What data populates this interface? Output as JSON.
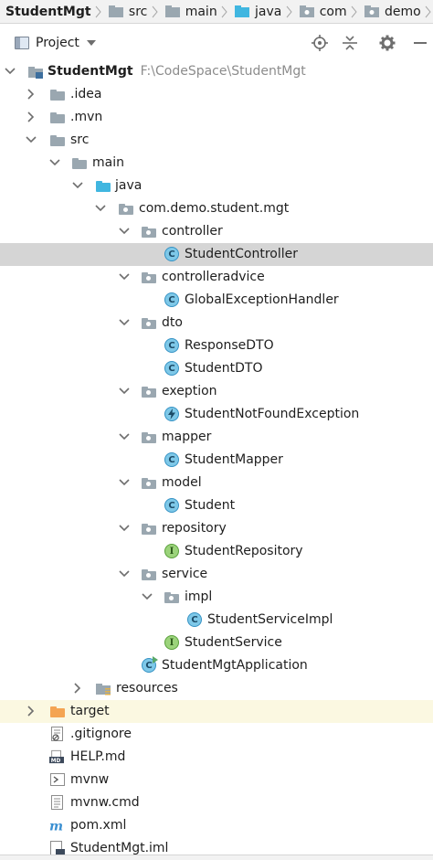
{
  "breadcrumb": [
    {
      "label": "StudentMgt",
      "icon": "module-folder-icon"
    },
    {
      "label": "src",
      "icon": "folder-icon"
    },
    {
      "label": "main",
      "icon": "folder-icon"
    },
    {
      "label": "java",
      "icon": "source-folder-icon"
    },
    {
      "label": "com",
      "icon": "package-icon"
    },
    {
      "label": "demo",
      "icon": "package-icon"
    }
  ],
  "toolbar": {
    "view_label": "Project",
    "buttons": [
      "locate-icon",
      "collapse-all-icon",
      "gear-icon",
      "hide-icon"
    ]
  },
  "tree": {
    "root_label": "StudentMgt",
    "root_path": "F:\\CodeSpace\\StudentMgt",
    "idea": ".idea",
    "mvn": ".mvn",
    "src": "src",
    "main": "main",
    "java": "java",
    "package": "com.demo.student.mgt",
    "controller": "controller",
    "StudentController": "StudentController",
    "controlleradvice": "controlleradvice",
    "GlobalExceptionHandler": "GlobalExceptionHandler",
    "dto": "dto",
    "ResponseDTO": "ResponseDTO",
    "StudentDTO": "StudentDTO",
    "exeption": "exeption",
    "StudentNotFoundException": "StudentNotFoundException",
    "mapper": "mapper",
    "StudentMapper": "StudentMapper",
    "model": "model",
    "Student": "Student",
    "repository": "repository",
    "StudentRepository": "StudentRepository",
    "service": "service",
    "impl": "impl",
    "StudentServiceImpl": "StudentServiceImpl",
    "StudentService": "StudentService",
    "StudentMgtApplication": "StudentMgtApplication",
    "resources": "resources",
    "target": "target",
    "gitignore": ".gitignore",
    "help": "HELP.md",
    "mvnw": "mvnw",
    "mvnw_cmd": "mvnw.cmd",
    "pom": "pom.xml",
    "iml": "StudentMgt.iml"
  },
  "colors": {
    "selected_row": "#d5d5d5",
    "excluded_row": "#fbf8e1",
    "folder": "#9aa7b0",
    "source_folder": "#40b6e0",
    "excluded_folder": "#f4a452",
    "class": "#7ec8e8",
    "interface": "#9bd37b",
    "path_text": "#8c8c8c"
  }
}
